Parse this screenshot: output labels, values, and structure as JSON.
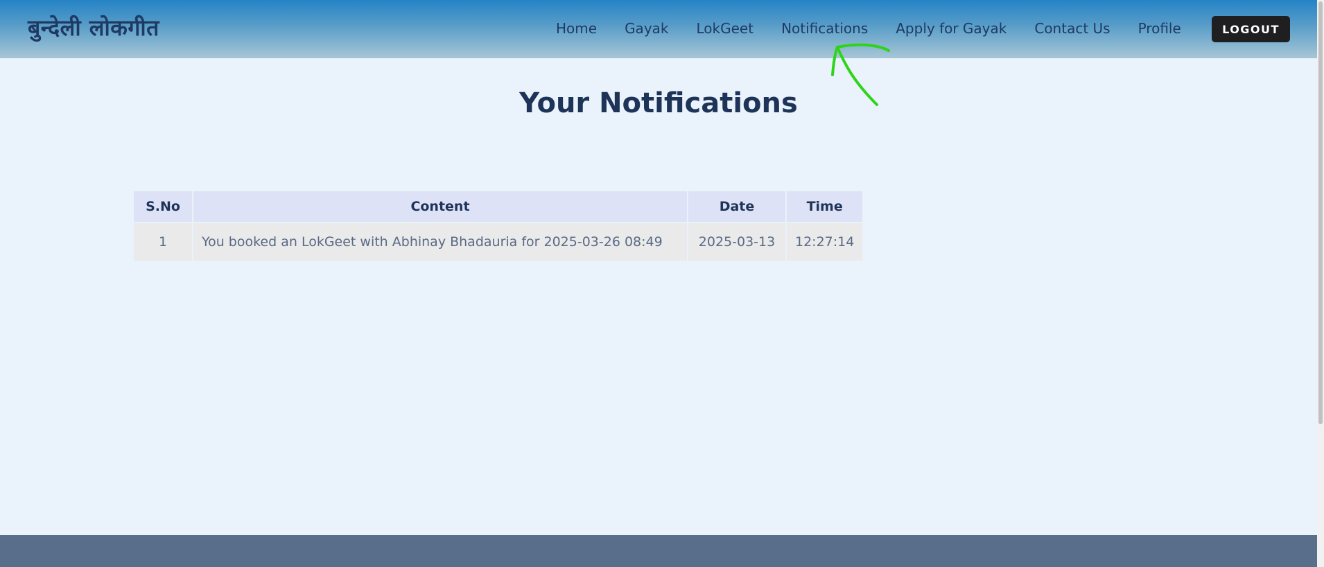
{
  "header": {
    "brand": "बुन्देली लोकगीत",
    "nav": [
      "Home",
      "Gayak",
      "LokGeet",
      "Notifications",
      "Apply for Gayak",
      "Contact Us",
      "Profile"
    ],
    "logout_label": "LOGOUT"
  },
  "main": {
    "title": "Your Notifications",
    "table": {
      "headers": [
        "S.No",
        "Content",
        "Date",
        "Time"
      ],
      "rows": [
        [
          "1",
          "You booked an LokGeet with Abhinay Bhadauria for 2025-03-26 08:49",
          "2025-03-13",
          "12:27:14"
        ]
      ]
    }
  },
  "colors": {
    "header_top": "#2583c5",
    "header_bottom": "#a7c6d6",
    "page_bg": "#eaf2fb",
    "text_dark": "#1f3358",
    "logout_bg": "#1f1f22",
    "table_header_bg": "#dde2f6",
    "table_cell_bg": "#eaeaea",
    "footer_bg": "#596e8b",
    "annotation": "#2fd41a"
  },
  "icons": {
    "annotation": "arrow-annotation-icon"
  }
}
